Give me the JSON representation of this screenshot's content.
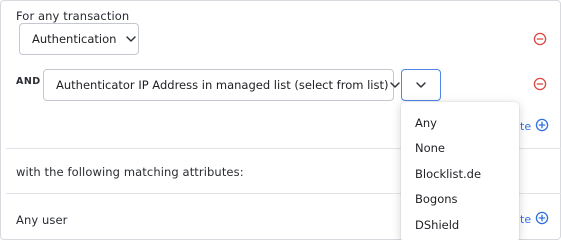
{
  "transaction": {
    "heading": "For any transaction",
    "type_select_value": "Authentication"
  },
  "condition": {
    "and_label": "AND",
    "attribute_select_value": "Authenticator IP Address in managed list (select from list)",
    "list_select_value": ""
  },
  "add_links": {
    "first_partial": "te",
    "second_partial": "te"
  },
  "matching": {
    "heading": "with the following matching attributes:"
  },
  "user_scope": {
    "label": "Any user"
  },
  "dropdown": {
    "options": [
      "Any",
      "None",
      "Blocklist.de",
      "Bogons",
      "DShield"
    ]
  },
  "colors": {
    "remove_icon": "#d9473f",
    "add_icon": "#2f6fe0",
    "border": "#c4c7cf"
  },
  "icons": {
    "remove": "minus-circle-icon",
    "add": "plus-circle-icon",
    "chevron": "chevron-down-icon"
  }
}
